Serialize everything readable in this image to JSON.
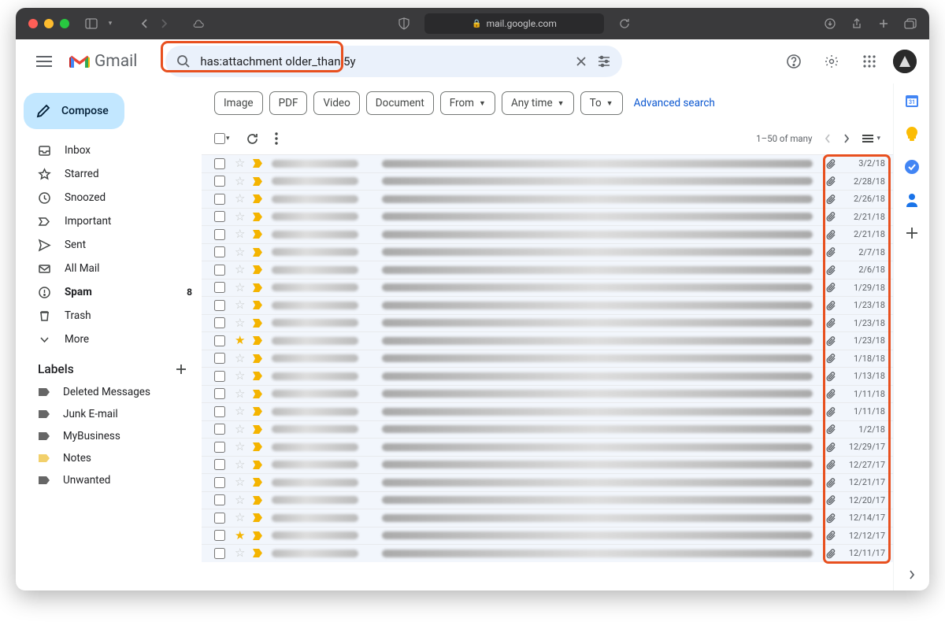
{
  "browser": {
    "url": "mail.google.com"
  },
  "header": {
    "app_name": "Gmail",
    "search_value": "has:attachment older_than:5y"
  },
  "compose_label": "Compose",
  "nav": [
    {
      "icon": "inbox",
      "label": "Inbox"
    },
    {
      "icon": "star",
      "label": "Starred"
    },
    {
      "icon": "clock",
      "label": "Snoozed"
    },
    {
      "icon": "important",
      "label": "Important"
    },
    {
      "icon": "send",
      "label": "Sent"
    },
    {
      "icon": "mail",
      "label": "All Mail"
    },
    {
      "icon": "spam",
      "label": "Spam",
      "bold": true,
      "badge": "8"
    },
    {
      "icon": "trash",
      "label": "Trash"
    },
    {
      "icon": "more",
      "label": "More"
    }
  ],
  "labels_header": "Labels",
  "labels": [
    {
      "label": "Deleted Messages",
      "color": "#666"
    },
    {
      "label": "Junk E-mail",
      "color": "#666"
    },
    {
      "label": "MyBusiness",
      "color": "#666"
    },
    {
      "label": "Notes",
      "color": "#f2d06b"
    },
    {
      "label": "Unwanted",
      "color": "#666"
    }
  ],
  "chips": [
    {
      "label": "Image"
    },
    {
      "label": "PDF"
    },
    {
      "label": "Video"
    },
    {
      "label": "Document"
    },
    {
      "label": "From",
      "caret": true
    },
    {
      "label": "Any time",
      "caret": true
    },
    {
      "label": "To",
      "caret": true
    }
  ],
  "advanced_search": "Advanced search",
  "pager_text": "1–50 of many",
  "rows": [
    {
      "date": "3/2/18",
      "star": false
    },
    {
      "date": "2/28/18",
      "star": false
    },
    {
      "date": "2/26/18",
      "star": false
    },
    {
      "date": "2/21/18",
      "star": false
    },
    {
      "date": "2/21/18",
      "star": false
    },
    {
      "date": "2/7/18",
      "star": false
    },
    {
      "date": "2/6/18",
      "star": false
    },
    {
      "date": "1/29/18",
      "star": false
    },
    {
      "date": "1/23/18",
      "star": false
    },
    {
      "date": "1/23/18",
      "star": false
    },
    {
      "date": "1/23/18",
      "star": true
    },
    {
      "date": "1/18/18",
      "star": false
    },
    {
      "date": "1/13/18",
      "star": false
    },
    {
      "date": "1/11/18",
      "star": false
    },
    {
      "date": "1/11/18",
      "star": false
    },
    {
      "date": "1/2/18",
      "star": false
    },
    {
      "date": "12/29/17",
      "star": false
    },
    {
      "date": "12/27/17",
      "star": false
    },
    {
      "date": "12/21/17",
      "star": false
    },
    {
      "date": "12/20/17",
      "star": false
    },
    {
      "date": "12/14/17",
      "star": false
    },
    {
      "date": "12/12/17",
      "star": true
    },
    {
      "date": "12/11/17",
      "star": false
    }
  ]
}
